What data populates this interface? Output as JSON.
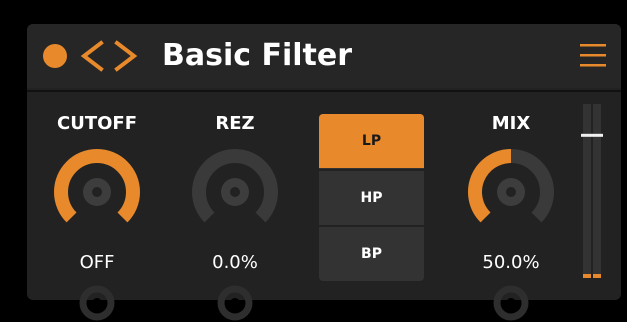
{
  "colors": {
    "accent": "#e8892b",
    "track": "#3a3a3a",
    "knob_center": "#3d3d3d",
    "port_ring": "#2e2e2e"
  },
  "header": {
    "title": "Basic Filter",
    "status_icon": "status-dot-icon",
    "prev_icon": "chevron-left-icon",
    "next_icon": "chevron-right-icon",
    "menu_icon": "hamburger-menu-icon"
  },
  "knobs": [
    {
      "id": "cutoff",
      "label": "CUTOFF",
      "value_text": "OFF",
      "level": 1.0
    },
    {
      "id": "rez",
      "label": "REZ",
      "value_text": "0.0%",
      "level": 0.0
    },
    {
      "id": "mix",
      "label": "MIX",
      "value_text": "50.0%",
      "level": 0.5
    }
  ],
  "filter_modes": {
    "options": [
      "LP",
      "HP",
      "BP"
    ],
    "selected": "LP"
  },
  "meter": {
    "level": 0.82
  }
}
